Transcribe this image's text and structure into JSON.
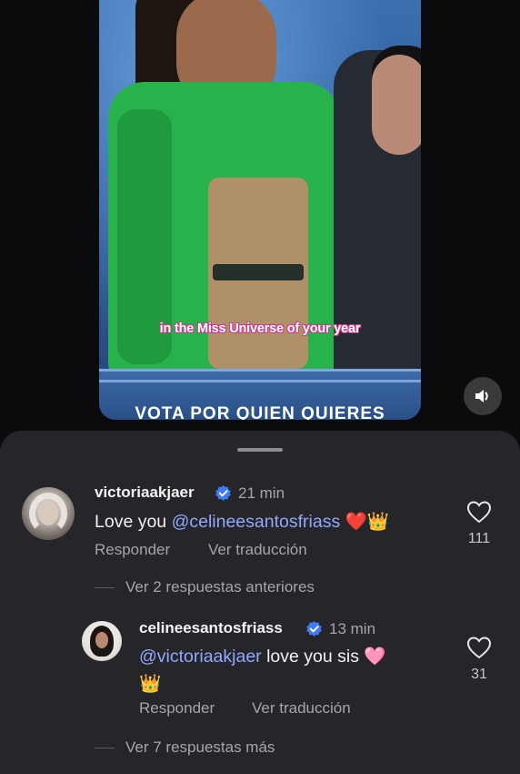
{
  "video": {
    "caption": "in the Miss Universe of your year",
    "banner_text": "VOTA POR QUIEN QUIERES"
  },
  "controls": {
    "sound_icon": "speaker-icon"
  },
  "comments": [
    {
      "username": "victoriaakjaer",
      "time": "21 min",
      "text_prefix": "Love you ",
      "mention": "@celineesantosfriass",
      "emoji": "❤️👑",
      "reply_label": "Responder",
      "translate_label": "Ver traducción",
      "likes": "111",
      "more_replies": "Ver 2 respuestas anteriores"
    },
    {
      "username": "celineesantosfriass",
      "time": "13 min",
      "mention": "@victoriaakjaer",
      "text_suffix": " love you sis ",
      "emoji_inline": "🩷",
      "emoji_line2": "👑",
      "reply_label": "Responder",
      "translate_label": "Ver traducción",
      "likes": "31",
      "more_replies": "Ver 7 respuestas más"
    }
  ],
  "colors": {
    "sheet_bg": "#26262a",
    "mention": "#8fa9ff",
    "verified": "#3f7bf6"
  }
}
